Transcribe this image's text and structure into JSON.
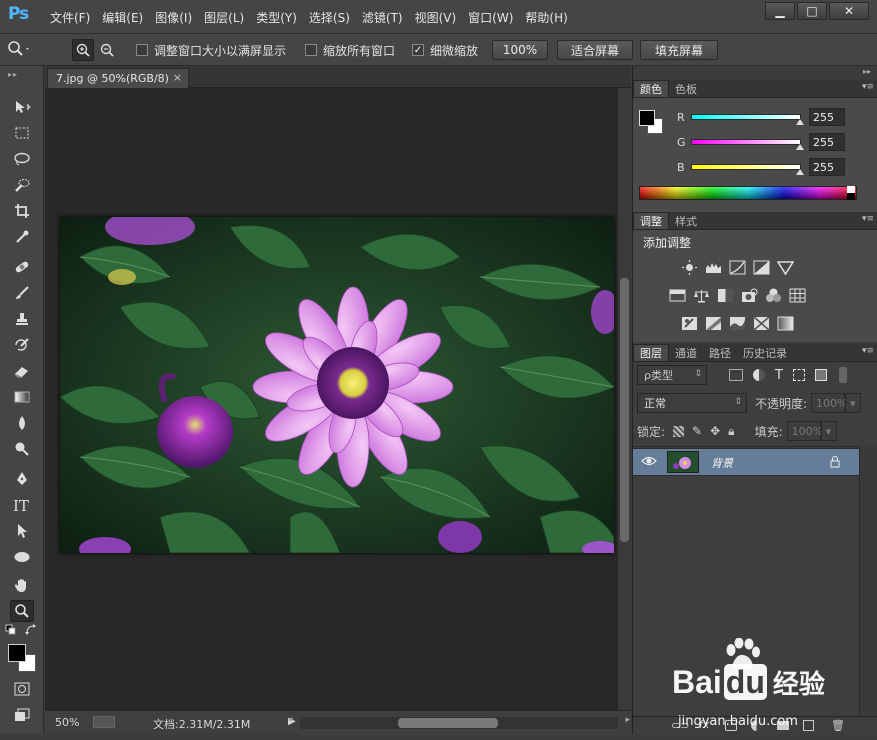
{
  "app": {
    "logo": "Ps",
    "menu": [
      "文件(F)",
      "编辑(E)",
      "图像(I)",
      "图层(L)",
      "类型(Y)",
      "选择(S)",
      "滤镜(T)",
      "视图(V)",
      "窗口(W)",
      "帮助(H)"
    ],
    "window_buttons": {
      "minimize": "▁",
      "maximize": "□",
      "close": "✕"
    }
  },
  "options": {
    "resize_windows_label": "调整窗口大小以满屏显示",
    "zoom_all_label": "缩放所有窗口",
    "scrubby_zoom_label": "细微缩放",
    "scrubby_zoom_checked": true,
    "btn_100": "100%",
    "btn_fit": "适合屏幕",
    "btn_fill": "填充屏幕"
  },
  "document": {
    "tab_title": "7.jpg @ 50%(RGB/8)",
    "tab_close": "×",
    "zoom": "50%",
    "doc_size": "文档:2.31M/2.31M"
  },
  "color_panel": {
    "tabs": [
      "颜色",
      "色板"
    ],
    "r_label": "R",
    "g_label": "G",
    "b_label": "B",
    "r": "255",
    "g": "255",
    "b": "255",
    "r_level": 1.0,
    "g_level": 1.0,
    "b_level": 1.0
  },
  "adjustments_panel": {
    "tabs": [
      "调整",
      "样式"
    ],
    "title": "添加调整"
  },
  "layers_panel": {
    "tabs": [
      "图层",
      "通道",
      "路径",
      "历史记录"
    ],
    "filter_label": "ρ类型",
    "blend_mode": "正常",
    "opacity_label": "不透明度:",
    "opacity_value": "100%",
    "lock_label": "锁定:",
    "fill_label": "填充:",
    "fill_value": "100%",
    "layer_name": "背景"
  },
  "watermark": {
    "brand": "Bai",
    "brand_mid": "du",
    "suffix": "经验",
    "url": "jingyan.baidu.com"
  },
  "colors": {
    "accent_blue": "#4fb7ff",
    "layer_selected": "#667d9a",
    "canvas_bg": "#282828"
  }
}
